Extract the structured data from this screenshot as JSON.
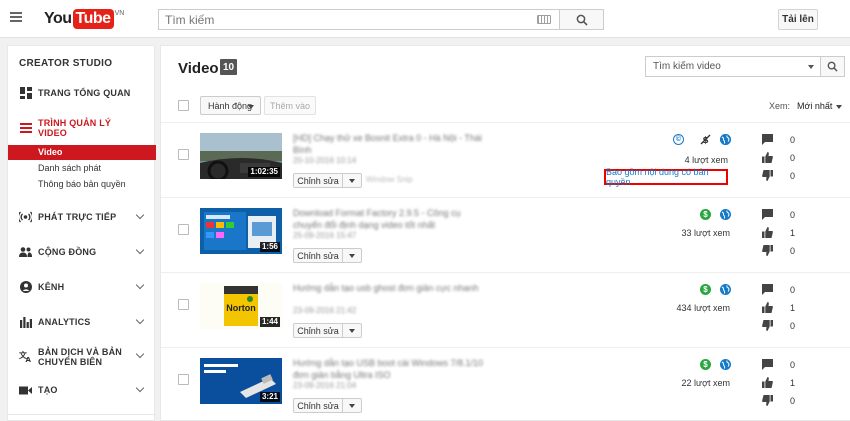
{
  "header": {
    "logo_you": "You",
    "logo_tube": "Tube",
    "logo_region": "VN",
    "search_placeholder": "Tìm kiếm",
    "upload_label": "Tải lên"
  },
  "sidebar": {
    "studio_title": "CREATOR STUDIO",
    "items": [
      {
        "label": "TRANG TỔNG QUAN",
        "icon": "dashboard-icon"
      },
      {
        "label": "TRÌNH QUẢN LÝ VIDEO",
        "icon": "video-manager-icon"
      },
      {
        "label": "PHÁT TRỰC TIẾP",
        "icon": "live-icon"
      },
      {
        "label": "CỘNG ĐỒNG",
        "icon": "community-icon"
      },
      {
        "label": "KÊNH",
        "icon": "channel-icon"
      },
      {
        "label": "ANALYTICS",
        "icon": "analytics-icon"
      },
      {
        "label": "BẢN DỊCH VÀ BẢN CHUYỂN BIÊN",
        "icon": "translate-icon"
      },
      {
        "label": "TẠO",
        "icon": "create-icon"
      }
    ],
    "sub_items": [
      "Video",
      "Danh sách phát",
      "Thông báo bản quyền"
    ]
  },
  "main": {
    "title": "Video",
    "count": "10",
    "search_placeholder": "Tìm kiếm video",
    "action_label": "Hành động",
    "add_label": "Thêm vào",
    "sort_label": "Xem:",
    "sort_value": "Mới nhất",
    "edit_label": "Chỉnh sửa",
    "copyright_label": "Bao gồm nội dung có bản quyền"
  },
  "videos": [
    {
      "duration": "1:02:35",
      "title": "[HD] Chạy thử xe Bosnit Extra 0 - Hà Nội - Thái Bình",
      "date": "20-10-2016 10:14",
      "extra": "Window Snip",
      "views": "4 lượt xem",
      "likes": "0",
      "dislikes": "0",
      "comments": "0",
      "icons": [
        "copyright-icon",
        "no-monetize-icon",
        "public-icon"
      ]
    },
    {
      "duration": "1:56",
      "title": "Download Format Factory 2.9.5 - Công cụ chuyển đổi định dạng video tốt nhất",
      "date": "25-09-2016 15:47",
      "extra": "",
      "views": "33 lượt xem",
      "likes": "1",
      "dislikes": "0",
      "comments": "0",
      "icons": [
        "monetize-icon",
        "public-icon"
      ]
    },
    {
      "duration": "1:44",
      "title": "Hướng dẫn tạo usb ghost đơn giản cực nhanh",
      "date": "23-09-2016 21:42",
      "extra": "",
      "views": "434 lượt xem",
      "likes": "1",
      "dislikes": "0",
      "comments": "0",
      "icons": [
        "monetize-icon",
        "public-icon"
      ]
    },
    {
      "duration": "3:21",
      "title": "Hướng dẫn tạo USB boot cài Windows 7/8.1/10 đơn giản bằng Ultra ISO",
      "date": "23-09-2016 21:04",
      "extra": "",
      "views": "22 lượt xem",
      "likes": "1",
      "dislikes": "0",
      "comments": "0",
      "icons": [
        "monetize-icon",
        "public-icon"
      ]
    }
  ],
  "colors": {
    "brand_red": "#e62117",
    "active_red": "#cc181e",
    "link_blue": "#167ac6",
    "monetize_green": "#2ba640",
    "highlight_border": "#ee0000"
  }
}
